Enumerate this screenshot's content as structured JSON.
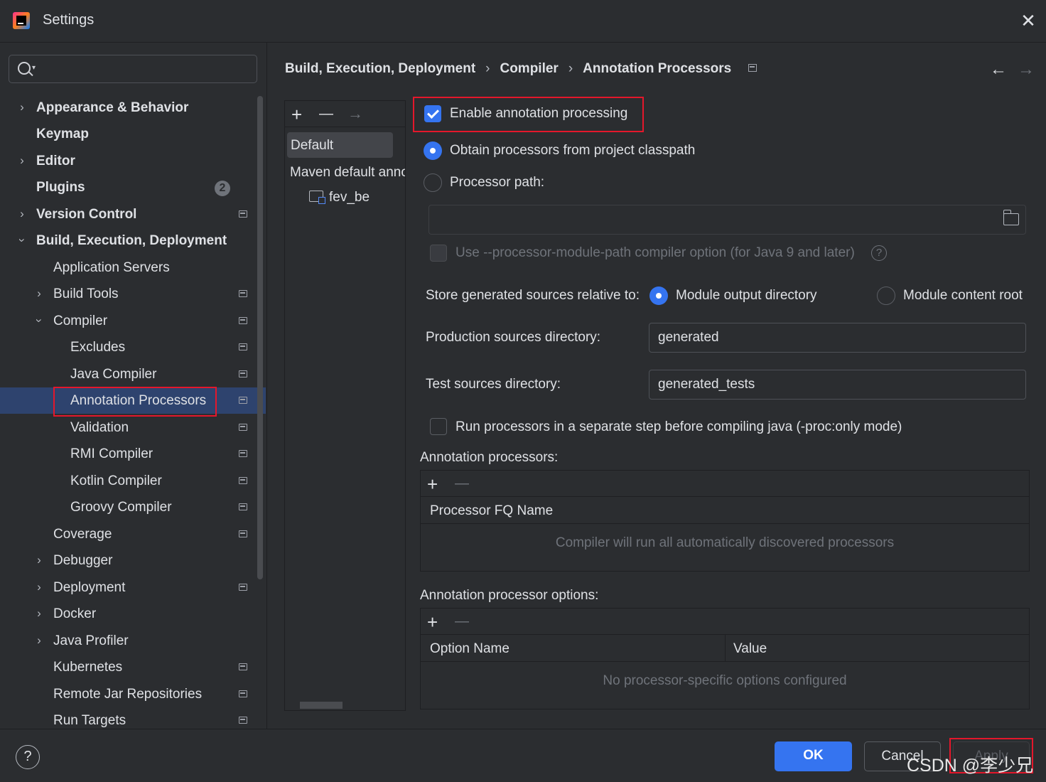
{
  "window": {
    "title": "Settings"
  },
  "search": {
    "placeholder": ""
  },
  "sidebar": {
    "items": [
      {
        "label": "Appearance & Behavior",
        "expanded": false
      },
      {
        "label": "Keymap"
      },
      {
        "label": "Editor",
        "expanded": false
      },
      {
        "label": "Plugins",
        "badge": "2"
      },
      {
        "label": "Version Control",
        "expanded": false
      },
      {
        "label": "Build, Execution, Deployment",
        "expanded": true
      },
      {
        "label": "Application Servers"
      },
      {
        "label": "Build Tools",
        "expanded": false
      },
      {
        "label": "Compiler",
        "expanded": true
      },
      {
        "label": "Excludes"
      },
      {
        "label": "Java Compiler"
      },
      {
        "label": "Annotation Processors",
        "selected": true
      },
      {
        "label": "Validation"
      },
      {
        "label": "RMI Compiler"
      },
      {
        "label": "Kotlin Compiler"
      },
      {
        "label": "Groovy Compiler"
      },
      {
        "label": "Coverage"
      },
      {
        "label": "Debugger",
        "expanded": false
      },
      {
        "label": "Deployment",
        "expanded": false
      },
      {
        "label": "Docker",
        "expanded": false
      },
      {
        "label": "Java Profiler",
        "expanded": false
      },
      {
        "label": "Kubernetes"
      },
      {
        "label": "Remote Jar Repositories"
      },
      {
        "label": "Run Targets"
      }
    ]
  },
  "breadcrumb": {
    "items": [
      "Build, Execution, Deployment",
      "Compiler",
      "Annotation Processors"
    ],
    "separator": "›"
  },
  "nav": {
    "back": "←",
    "forward": "→"
  },
  "profiles": {
    "toolbar": {
      "add": "+",
      "remove": "—",
      "move": "→"
    },
    "default_label": "Default",
    "maven_label": "Maven default annotation processors profile",
    "module_label": "fev_be"
  },
  "processing": {
    "enable_label": "Enable annotation processing",
    "enable_checked": true,
    "classpath_label": "Obtain processors from project classpath",
    "classpath_selected": true,
    "processor_path_label": "Processor path:",
    "processor_path_value": "",
    "module_path_label": "Use --processor-module-path compiler option (for Java 9 and later)",
    "module_path_checked": false,
    "help_glyph": "?"
  },
  "generated": {
    "store_label": "Store generated sources relative to:",
    "module_output_label": "Module output directory",
    "module_output_selected": true,
    "content_root_label": "Module content root",
    "production_label": "Production sources directory:",
    "production_value": "generated",
    "test_label": "Test sources directory:",
    "test_value": "generated_tests",
    "run_separately_label": "Run processors in a separate step before compiling java (-proc:only mode)",
    "run_separately_checked": false
  },
  "processors_table": {
    "title": "Annotation processors:",
    "add": "+",
    "remove": "—",
    "columns": [
      "Processor FQ Name"
    ],
    "empty_text": "Compiler will run all automatically discovered processors"
  },
  "options_table": {
    "title": "Annotation processor options:",
    "add": "+",
    "remove": "—",
    "columns": [
      "Option Name",
      "Value"
    ],
    "empty_text": "No processor-specific options configured"
  },
  "footer": {
    "help": "?",
    "ok": "OK",
    "cancel": "Cancel",
    "apply": "Apply"
  },
  "watermark": "CSDN @李少兄",
  "colors": {
    "accent": "#3574f0",
    "selection": "#2e436e",
    "highlight_box": "#e4172b",
    "background": "#2b2d30"
  }
}
